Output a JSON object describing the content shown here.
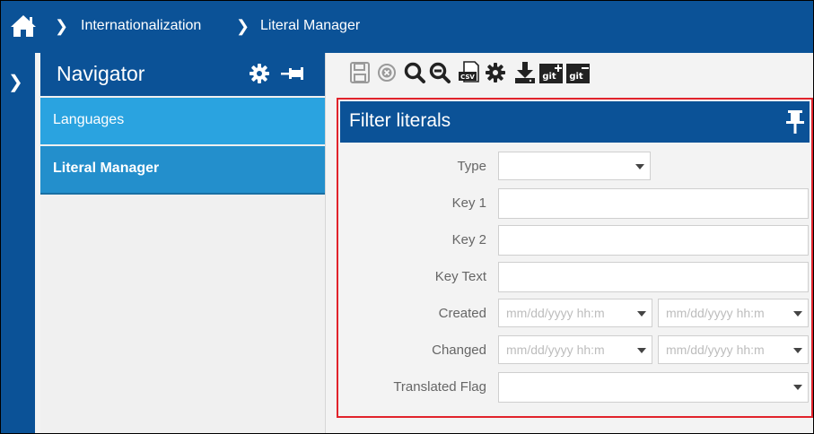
{
  "breadcrumb": {
    "home_icon": "home-icon",
    "items": [
      "Internationalization",
      "Literal Manager"
    ]
  },
  "navigator": {
    "title": "Navigator",
    "items": [
      {
        "label": "Languages"
      },
      {
        "label": "Literal Manager",
        "selected": true
      }
    ]
  },
  "toolbar": {
    "icons": [
      "save-icon",
      "cancel-icon",
      "search-icon",
      "zoom-out-icon",
      "csv-export-icon",
      "settings-icon",
      "download-icon",
      "git-add-icon",
      "git-remove-icon"
    ],
    "git_label": "git"
  },
  "filter": {
    "title": "Filter literals",
    "fields": {
      "type": {
        "label": "Type",
        "value": ""
      },
      "key1": {
        "label": "Key 1",
        "value": ""
      },
      "key2": {
        "label": "Key 2",
        "value": ""
      },
      "key_text": {
        "label": "Key Text",
        "value": ""
      },
      "created": {
        "label": "Created",
        "from_placeholder": "mm/dd/yyyy hh:m",
        "to_placeholder": "mm/dd/yyyy hh:m"
      },
      "changed": {
        "label": "Changed",
        "from_placeholder": "mm/dd/yyyy hh:m",
        "to_placeholder": "mm/dd/yyyy hh:m"
      },
      "translated_flag": {
        "label": "Translated Flag",
        "value": ""
      }
    }
  },
  "colors": {
    "header_blue": "#0b5297",
    "nav_item_blue": "#2aa3e0",
    "highlight_border": "#e1232b"
  }
}
